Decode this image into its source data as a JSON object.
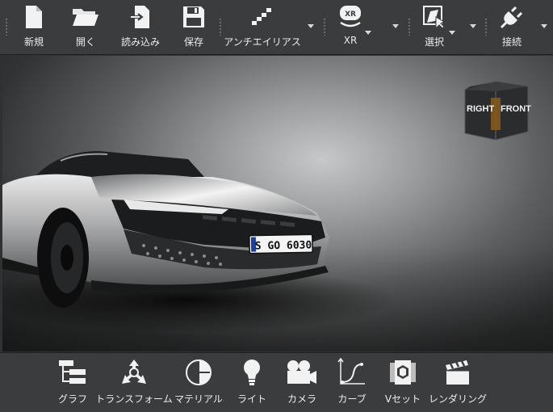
{
  "toolbar": {
    "items": [
      {
        "label": "新規",
        "icon": "new-file-icon"
      },
      {
        "label": "開く",
        "icon": "open-folder-icon"
      },
      {
        "label": "読み込み",
        "icon": "import-icon"
      },
      {
        "label": "保存",
        "icon": "save-disk-icon"
      },
      {
        "label": "アンチエイリアス",
        "icon": "antialias-icon"
      },
      {
        "label": "XR",
        "icon": "xr-headset-icon"
      },
      {
        "label": "選択",
        "icon": "select-icon"
      },
      {
        "label": "接続",
        "icon": "plug-icon"
      }
    ]
  },
  "viewport": {
    "navcube": {
      "left": "RIGHT",
      "right": "FRONT"
    },
    "plate": "S GO 6030"
  },
  "bottombar": {
    "items": [
      {
        "label": "グラフ",
        "icon": "graph-tree-icon"
      },
      {
        "label": "トランスフォーム",
        "icon": "transform-icon"
      },
      {
        "label": "マテリアル",
        "icon": "material-sphere-icon"
      },
      {
        "label": "ライト",
        "icon": "light-bulb-icon"
      },
      {
        "label": "カメラ",
        "icon": "camera-icon"
      },
      {
        "label": "カーブ",
        "icon": "curve-icon"
      },
      {
        "label": "Vセット",
        "icon": "variant-set-icon"
      },
      {
        "label": "レンダリング",
        "icon": "render-clapper-icon"
      }
    ]
  },
  "colors": {
    "toolbar_bg": "#3a3c3e",
    "viewport_center": "#c7c8c9",
    "viewport_edge": "#222324",
    "navcube_accent": "#8a5a1c"
  }
}
